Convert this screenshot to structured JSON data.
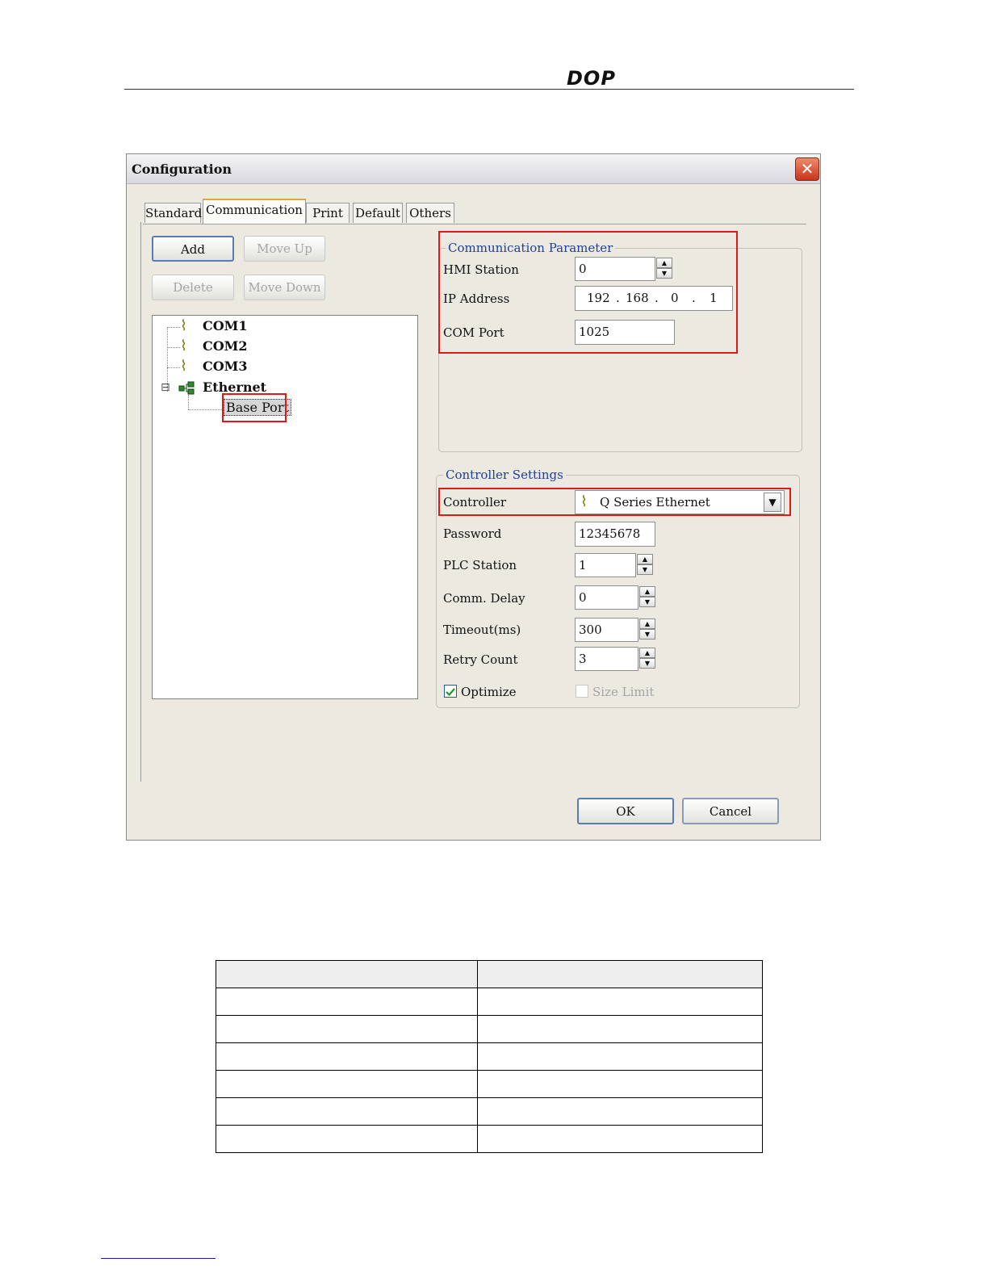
{
  "page_header": {
    "logo": "DOP"
  },
  "dialog": {
    "title": "Configuration",
    "close": "✕",
    "tabs": [
      "Standard",
      "Communication",
      "Print",
      "Default",
      "Others"
    ],
    "active_tab": "Communication",
    "buttons": {
      "add": "Add",
      "move_up": "Move Up",
      "delete": "Delete",
      "move_down": "Move Down"
    },
    "tree": {
      "items": [
        "COM1",
        "COM2",
        "COM3",
        "Ethernet"
      ],
      "child": "Base Port",
      "expander": "⊟"
    },
    "comm_param": {
      "legend": "Communication Parameter",
      "hmi_station_label": "HMI Station",
      "hmi_station_value": "0",
      "ip_label": "IP Address",
      "ip": [
        "192",
        "168",
        "0",
        "1"
      ],
      "ip_sep": ".",
      "com_port_label": "COM Port",
      "com_port_value": "1025"
    },
    "controller": {
      "legend": "Controller Settings",
      "controller_label": "Controller",
      "controller_value": "Q Series Ethernet",
      "password_label": "Password",
      "password_value": "12345678",
      "plc_station_label": "PLC Station",
      "plc_station_value": "1",
      "comm_delay_label": "Comm. Delay",
      "comm_delay_value": "0",
      "timeout_label": "Timeout(ms)",
      "timeout_value": "300",
      "retry_label": "Retry Count",
      "retry_value": "3",
      "optimize_label": "Optimize",
      "optimize_checked": true,
      "size_limit_label": "Size Limit",
      "size_limit_checked": false
    },
    "ok": "OK",
    "cancel": "Cancel"
  }
}
